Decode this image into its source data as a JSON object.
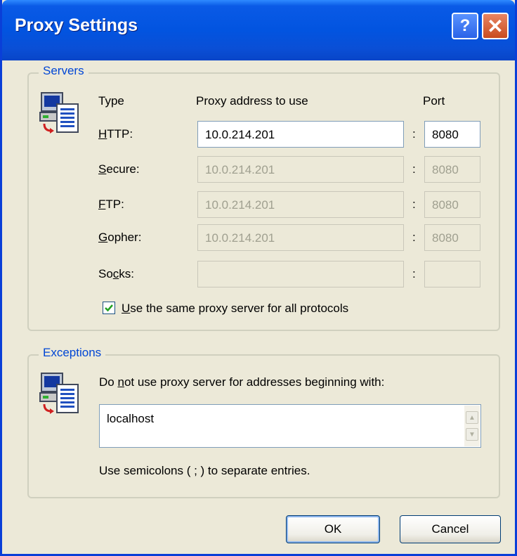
{
  "window": {
    "title": "Proxy Settings",
    "help": "?",
    "close": "✕"
  },
  "servers": {
    "legend": "Servers",
    "col_type": "Type",
    "col_address": "Proxy address to use",
    "col_port": "Port",
    "rows": [
      {
        "label_pre": "",
        "label_u": "H",
        "label_post": "TTP:",
        "address": "10.0.214.201",
        "port": "8080",
        "enabled": true
      },
      {
        "label_pre": "",
        "label_u": "S",
        "label_post": "ecure:",
        "address": "10.0.214.201",
        "port": "8080",
        "enabled": false
      },
      {
        "label_pre": "",
        "label_u": "F",
        "label_post": "TP:",
        "address": "10.0.214.201",
        "port": "8080",
        "enabled": false
      },
      {
        "label_pre": "",
        "label_u": "G",
        "label_post": "opher:",
        "address": "10.0.214.201",
        "port": "8080",
        "enabled": false
      },
      {
        "label_pre": "So",
        "label_u": "c",
        "label_post": "ks:",
        "address": "",
        "port": "",
        "enabled": false
      }
    ],
    "colon": ":",
    "same_proxy": {
      "u": "U",
      "rest": "se the same proxy server for all protocols",
      "checked": true
    }
  },
  "exceptions": {
    "legend": "Exceptions",
    "desc_pre": "Do ",
    "desc_u": "n",
    "desc_post": "ot use proxy server for addresses beginning with:",
    "value": "localhost",
    "hint": "Use semicolons ( ; ) to separate entries."
  },
  "buttons": {
    "ok": "OK",
    "cancel": "Cancel"
  }
}
